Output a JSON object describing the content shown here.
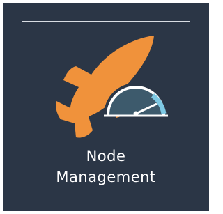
{
  "tile": {
    "label_line1": "Node",
    "label_line2": "Management",
    "icon": "rocket-speedometer-icon"
  },
  "colors": {
    "background": "#2b3646",
    "frame_border": "#d9dde3",
    "rocket": "#f0923b",
    "gauge_face": "#3d5a6c",
    "gauge_arc": "#7ec9e4",
    "text": "#ffffff"
  }
}
